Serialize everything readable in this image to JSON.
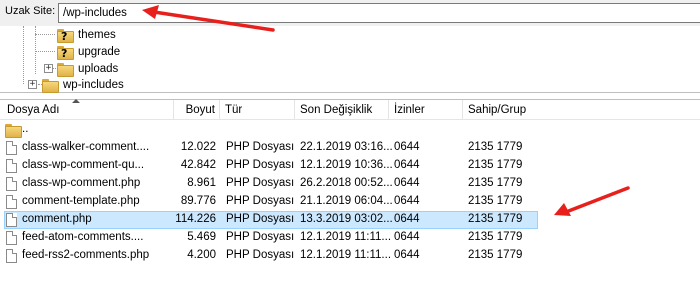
{
  "remote_site": {
    "label": "Uzak Site:",
    "path": "/wp-includes"
  },
  "tree": {
    "items": [
      {
        "label": "themes",
        "icon": "question-folder-icon"
      },
      {
        "label": "upgrade",
        "icon": "question-folder-icon"
      },
      {
        "label": "uploads",
        "icon": "folder-icon",
        "expander": "+"
      },
      {
        "label": "wp-includes",
        "icon": "folder-icon",
        "expander": "+"
      }
    ]
  },
  "file_list": {
    "columns": {
      "name": "Dosya Adı",
      "size": "Boyut",
      "type": "Tür",
      "modified": "Son Değişiklik",
      "permissions": "İzinler",
      "owner": "Sahip/Grup"
    },
    "parent": "..",
    "rows": [
      {
        "name": "class-walker-comment....",
        "size": "12.022",
        "type": "PHP Dosyası",
        "modified": "22.1.2019 03:16...",
        "permissions": "0644",
        "owner": "2135 1779"
      },
      {
        "name": "class-wp-comment-qu...",
        "size": "42.842",
        "type": "PHP Dosyası",
        "modified": "12.1.2019 10:36...",
        "permissions": "0644",
        "owner": "2135 1779"
      },
      {
        "name": "class-wp-comment.php",
        "size": "8.961",
        "type": "PHP Dosyası",
        "modified": "26.2.2018 00:52...",
        "permissions": "0644",
        "owner": "2135 1779"
      },
      {
        "name": "comment-template.php",
        "size": "89.776",
        "type": "PHP Dosyası",
        "modified": "21.1.2019 06:04...",
        "permissions": "0644",
        "owner": "2135 1779"
      },
      {
        "name": "comment.php",
        "size": "114.226",
        "type": "PHP Dosyası",
        "modified": "13.3.2019 03:02...",
        "permissions": "0644",
        "owner": "2135 1779",
        "selected": true
      },
      {
        "name": "feed-atom-comments....",
        "size": "5.469",
        "type": "PHP Dosyası",
        "modified": "12.1.2019 11:11...",
        "permissions": "0644",
        "owner": "2135 1779"
      },
      {
        "name": "feed-rss2-comments.php",
        "size": "4.200",
        "type": "PHP Dosyası",
        "modified": "12.1.2019 11:11...",
        "permissions": "0644",
        "owner": "2135 1779"
      }
    ]
  },
  "colors": {
    "selection": "#cce8ff",
    "annotation_arrow": "#e8201c",
    "folder": "#f6d77a"
  }
}
